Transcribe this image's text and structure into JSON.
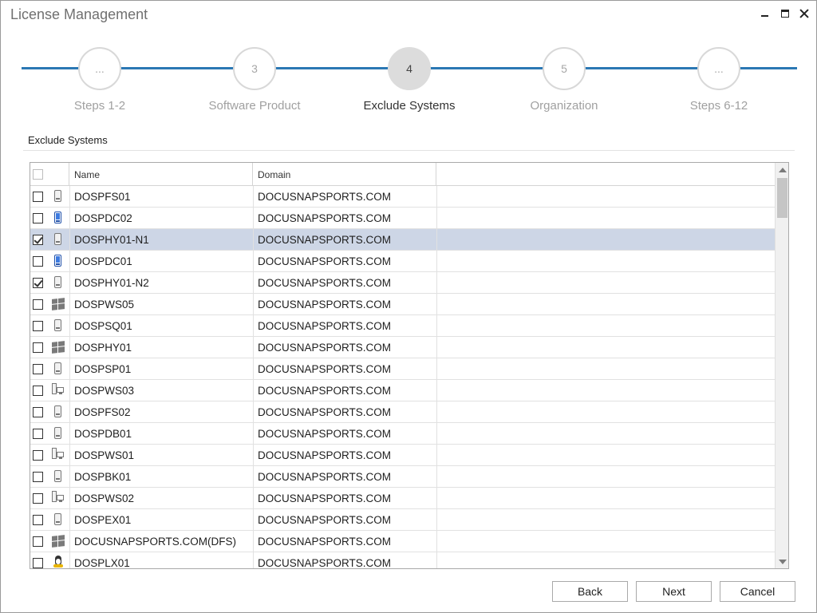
{
  "window": {
    "title": "License Management",
    "controls": {
      "minimize": "minimize",
      "maximize": "maximize",
      "close": "close"
    }
  },
  "stepper": {
    "accent_color": "#2b78b4",
    "active_index": 2,
    "steps": [
      {
        "badge": "...",
        "label": "Steps 1-2"
      },
      {
        "badge": "3",
        "label": "Software Product"
      },
      {
        "badge": "4",
        "label": "Exclude Systems"
      },
      {
        "badge": "5",
        "label": "Organization"
      },
      {
        "badge": "...",
        "label": "Steps 6-12"
      }
    ]
  },
  "section": {
    "title": "Exclude Systems"
  },
  "grid": {
    "columns": {
      "name": "Name",
      "domain": "Domain"
    },
    "header_checkbox_checked": false,
    "rows": [
      {
        "checked": false,
        "selected": false,
        "icon": "server-icon",
        "name": "DOSPFS01",
        "domain": "DOCUSNAPSPORTS.COM"
      },
      {
        "checked": false,
        "selected": false,
        "icon": "domain-controller-icon",
        "name": "DOSPDC02",
        "domain": "DOCUSNAPSPORTS.COM"
      },
      {
        "checked": true,
        "selected": true,
        "icon": "server-icon",
        "name": "DOSPHY01-N1",
        "domain": "DOCUSNAPSPORTS.COM"
      },
      {
        "checked": false,
        "selected": false,
        "icon": "domain-controller-icon",
        "name": "DOSPDC01",
        "domain": "DOCUSNAPSPORTS.COM"
      },
      {
        "checked": true,
        "selected": false,
        "icon": "server-icon",
        "name": "DOSPHY01-N2",
        "domain": "DOCUSNAPSPORTS.COM"
      },
      {
        "checked": false,
        "selected": false,
        "icon": "windows-icon",
        "name": "DOSPWS05",
        "domain": "DOCUSNAPSPORTS.COM"
      },
      {
        "checked": false,
        "selected": false,
        "icon": "server-icon",
        "name": "DOSPSQ01",
        "domain": "DOCUSNAPSPORTS.COM"
      },
      {
        "checked": false,
        "selected": false,
        "icon": "windows-icon",
        "name": "DOSPHY01",
        "domain": "DOCUSNAPSPORTS.COM"
      },
      {
        "checked": false,
        "selected": false,
        "icon": "server-icon",
        "name": "DOSPSP01",
        "domain": "DOCUSNAPSPORTS.COM"
      },
      {
        "checked": false,
        "selected": false,
        "icon": "workstation-icon",
        "name": "DOSPWS03",
        "domain": "DOCUSNAPSPORTS.COM"
      },
      {
        "checked": false,
        "selected": false,
        "icon": "server-icon",
        "name": "DOSPFS02",
        "domain": "DOCUSNAPSPORTS.COM"
      },
      {
        "checked": false,
        "selected": false,
        "icon": "server-icon",
        "name": "DOSPDB01",
        "domain": "DOCUSNAPSPORTS.COM"
      },
      {
        "checked": false,
        "selected": false,
        "icon": "workstation-icon",
        "name": "DOSPWS01",
        "domain": "DOCUSNAPSPORTS.COM"
      },
      {
        "checked": false,
        "selected": false,
        "icon": "server-icon",
        "name": "DOSPBK01",
        "domain": "DOCUSNAPSPORTS.COM"
      },
      {
        "checked": false,
        "selected": false,
        "icon": "workstation-icon",
        "name": "DOSPWS02",
        "domain": "DOCUSNAPSPORTS.COM"
      },
      {
        "checked": false,
        "selected": false,
        "icon": "server-icon",
        "name": "DOSPEX01",
        "domain": "DOCUSNAPSPORTS.COM"
      },
      {
        "checked": false,
        "selected": false,
        "icon": "windows-icon",
        "name": "DOCUSNAPSPORTS.COM(DFS)",
        "domain": "DOCUSNAPSPORTS.COM"
      },
      {
        "checked": false,
        "selected": false,
        "icon": "linux-icon",
        "name": "DOSPLX01",
        "domain": "DOCUSNAPSPORTS.COM"
      }
    ]
  },
  "footer": {
    "back_label": "Back",
    "next_label": "Next",
    "cancel_label": "Cancel"
  }
}
